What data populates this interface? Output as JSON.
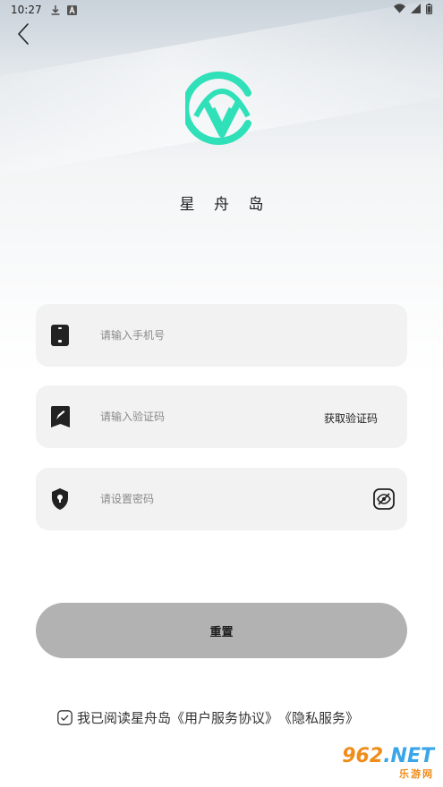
{
  "status_bar": {
    "time": "10:27"
  },
  "app": {
    "name": "星 舟 岛"
  },
  "form": {
    "phone_placeholder": "请输入手机号",
    "code_placeholder": "请输入验证码",
    "get_code_label": "获取验证码",
    "password_placeholder": "请设置密码"
  },
  "actions": {
    "reset_label": "重置"
  },
  "agreement": {
    "prefix": "我已阅读星舟岛",
    "user_agreement": "《用户服务协议》",
    "privacy": "《隐私服务》",
    "checked": false
  },
  "watermark": {
    "top_number": "962",
    "top_suffix": ".NET",
    "bottom": "乐游网"
  },
  "colors": {
    "logo_accent": "#2fe0b8",
    "button_bg": "#b2b2b2",
    "field_bg": "#f2f2f2"
  },
  "icons": {
    "back": "chevron-left-icon",
    "phone": "phone-icon",
    "code": "verify-code-icon",
    "password": "lock-shield-icon",
    "eye": "eye-off-icon",
    "checkbox": "checkbox-icon"
  }
}
